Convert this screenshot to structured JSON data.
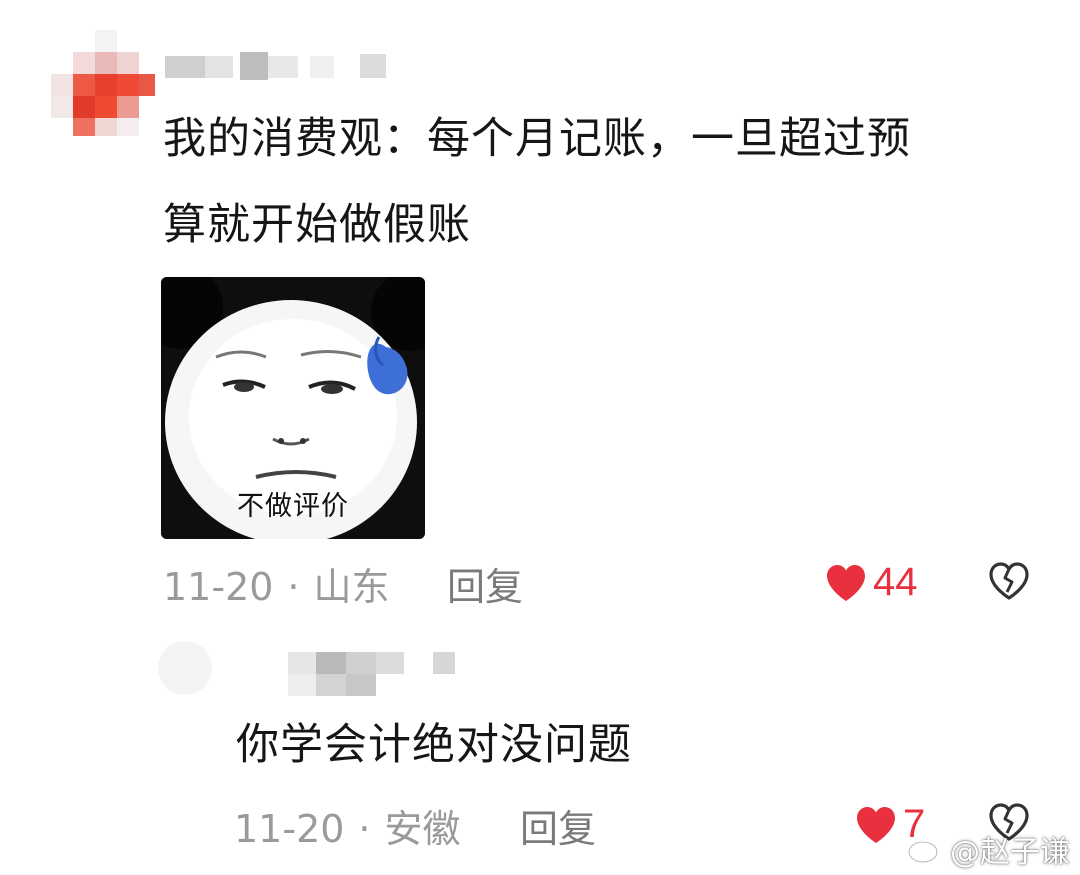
{
  "comments": [
    {
      "text_line1": "我的消费观：每个月记账，一旦超过预",
      "text_line2": "算就开始做假账",
      "sticker": {
        "caption": "不做评价",
        "icon": "panda-meme-sticker"
      },
      "date": "11-20",
      "separator": "·",
      "location": "山东",
      "reply_label": "回复",
      "likes": "44",
      "like_icon": "heart-filled-icon",
      "dislike_icon": "broken-heart-icon"
    },
    {
      "text": "你学会计绝对没问题",
      "date": "11-20",
      "separator": "·",
      "location": "安徽",
      "reply_label": "回复",
      "likes": "7",
      "like_icon": "heart-filled-icon",
      "dislike_icon": "broken-heart-icon"
    }
  ],
  "watermark": {
    "text": "@赵子谦",
    "icon": "weibo-icon"
  },
  "colors": {
    "like_red": "#e8303f",
    "meta_gray": "#9a9a9a",
    "text": "#161616"
  }
}
